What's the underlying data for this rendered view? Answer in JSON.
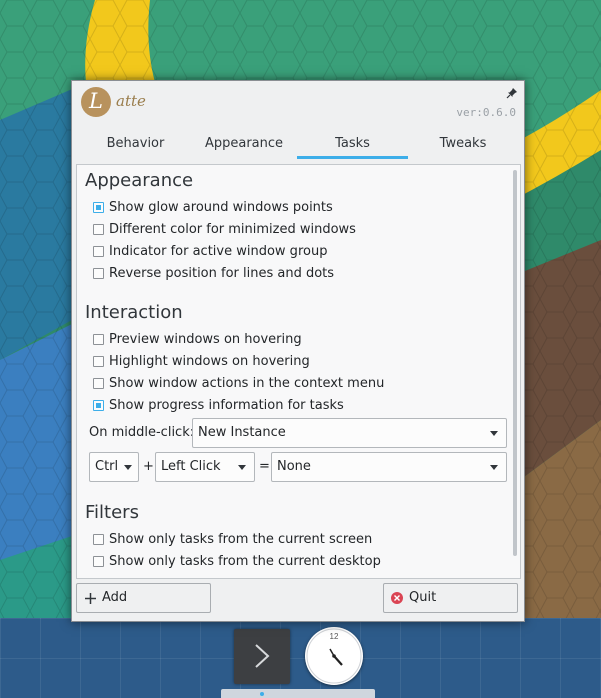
{
  "app": {
    "logo_letter": "L",
    "logo_text": "atte",
    "version": "ver:0.6.0"
  },
  "tabs": [
    {
      "label": "Behavior"
    },
    {
      "label": "Appearance"
    },
    {
      "label": "Tasks",
      "active": true
    },
    {
      "label": "Tweaks"
    }
  ],
  "appearance": {
    "title": "Appearance",
    "options": [
      {
        "label": "Show glow around windows points",
        "checked": true
      },
      {
        "label": "Different color for minimized windows",
        "checked": false
      },
      {
        "label": "Indicator for active window group",
        "checked": false
      },
      {
        "label": "Reverse position for lines and dots",
        "checked": false
      }
    ]
  },
  "interaction": {
    "title": "Interaction",
    "options": [
      {
        "label": "Preview windows on hovering",
        "checked": false
      },
      {
        "label": "Highlight windows on hovering",
        "checked": false
      },
      {
        "label": "Show window actions in the context menu",
        "checked": false
      },
      {
        "label": "Show progress information for tasks",
        "checked": true
      }
    ],
    "middle_click_label": "On middle-click:",
    "middle_click_value": "New Instance",
    "modifier_value": "Ctrl",
    "plus_sign": "+",
    "click_value": "Left Click",
    "equals_sign": "=",
    "action_value": "None"
  },
  "filters": {
    "title": "Filters",
    "options": [
      {
        "label": "Show only tasks from the current screen",
        "checked": false
      },
      {
        "label": "Show only tasks from the current desktop",
        "checked": false
      }
    ]
  },
  "buttons": {
    "add_label": "Add",
    "quit_label": "Quit"
  },
  "colors": {
    "accent": "#3daee9",
    "logo": "#b8925d",
    "quit": "#da4453"
  }
}
